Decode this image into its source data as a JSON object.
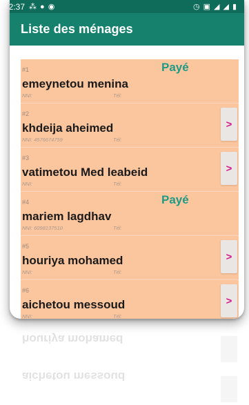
{
  "status_bar": {
    "time": "02:37",
    "left_icons": [
      "apps-icon",
      "record-icon",
      "camera-icon"
    ],
    "right_icons": [
      "alarm-icon",
      "screen-icon",
      "signal-icon",
      "signal-icon",
      "battery-icon"
    ]
  },
  "header": {
    "title": "Liste des ménages"
  },
  "colors": {
    "status_bar": "#0f6b5a",
    "app_bar": "#16826e",
    "card": "#fbc59d",
    "paid": "#1e9b86",
    "arrow": "#d6178a"
  },
  "households": [
    {
      "index": "#1",
      "name": "emeynetou menina",
      "nni_label": "NNI:",
      "tel_label": "Tél:",
      "status": "Payé"
    },
    {
      "index": "#2",
      "name": "khdeija aheimed",
      "nni_label": "NNI: 4576674759",
      "tel_label": "Tél:",
      "action": ">"
    },
    {
      "index": "#3",
      "name": "vatimetou Med leabeid",
      "nni_label": "NNI:",
      "tel_label": "Tél:",
      "action": ">"
    },
    {
      "index": "#4",
      "name": "mariem lagdhav",
      "nni_label": "NNI: 6098137510",
      "tel_label": "Tél:",
      "status": "Payé"
    },
    {
      "index": "#5",
      "name": "houriya mohamed",
      "nni_label": "NNI:",
      "tel_label": "Tél:",
      "action": ">"
    },
    {
      "index": "#6",
      "name": "aichetou messoud",
      "nni_label": "NNI:",
      "tel_label": "Tél:",
      "action": ">"
    }
  ]
}
